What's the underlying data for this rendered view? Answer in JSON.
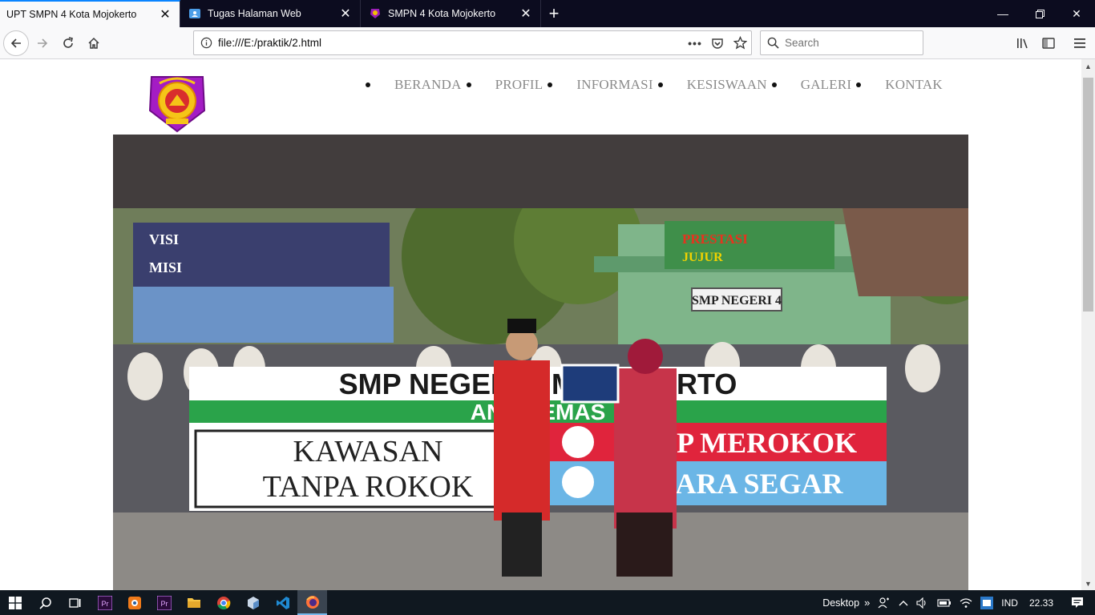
{
  "browser": {
    "tabs": [
      {
        "title": "UPT SMPN 4 Kota Mojokerto",
        "active": true
      },
      {
        "title": "Tugas Halaman Web",
        "active": false
      },
      {
        "title": "SMPN 4 Kota Mojokerto",
        "active": false
      }
    ],
    "url": "file:///E:/praktik/2.html",
    "search_placeholder": "Search",
    "accent_color": "#0a84ff"
  },
  "site": {
    "nav": [
      "BERANDA",
      "PROFIL",
      "INFORMASI",
      "KESISWAAN",
      "GALERI",
      "KONTAK"
    ],
    "hero_band_color": "#423d3d",
    "banner": {
      "school": "SMP NEGERI 4 MOJOKERTO",
      "motto_partial": "ANDA  EMAS",
      "left_line1": "KAWASAN",
      "left_line2": "TANPA ROKOK",
      "right_line1": "STOP MEROKOK",
      "right_line2": "UDARA SEGAR",
      "building_sign": "SMP NEGERI 4",
      "prestasi": "PRESTASI",
      "jujur": "JUJUR",
      "visi": "VISI",
      "misi": "MISI"
    }
  },
  "taskbar": {
    "desktop_label": "Desktop",
    "language": "IND",
    "time": "22.33"
  }
}
